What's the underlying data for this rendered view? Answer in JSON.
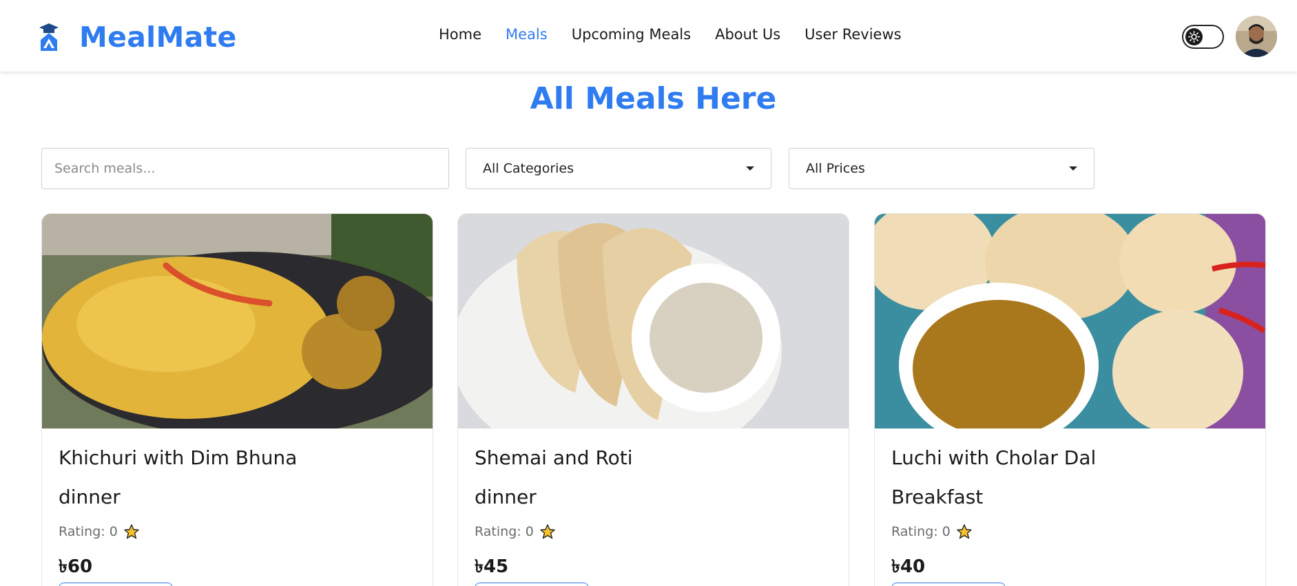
{
  "brand": {
    "name": "MealMate",
    "accent": "#2f7cf0"
  },
  "nav": {
    "links": [
      {
        "label": "Home",
        "active": false
      },
      {
        "label": "Meals",
        "active": true
      },
      {
        "label": "Upcoming Meals",
        "active": false
      },
      {
        "label": "About Us",
        "active": false
      },
      {
        "label": "User Reviews",
        "active": false
      }
    ],
    "theme_toggle_icon": "sun-icon",
    "avatar_icon": "user-avatar"
  },
  "page": {
    "title": "All Meals Here"
  },
  "filters": {
    "search_placeholder": "Search meals...",
    "category_selected": "All Categories",
    "price_selected": "All Prices"
  },
  "meals": [
    {
      "title": "Khichuri with Dim Bhuna",
      "category": "dinner",
      "rating_label": "Rating: 0",
      "price": "৳60"
    },
    {
      "title": "Shemai and Roti",
      "category": "dinner",
      "rating_label": "Rating: 0",
      "price": "৳45"
    },
    {
      "title": "Luchi with Cholar Dal",
      "category": "Breakfast",
      "rating_label": "Rating: 0",
      "price": "৳40"
    }
  ]
}
